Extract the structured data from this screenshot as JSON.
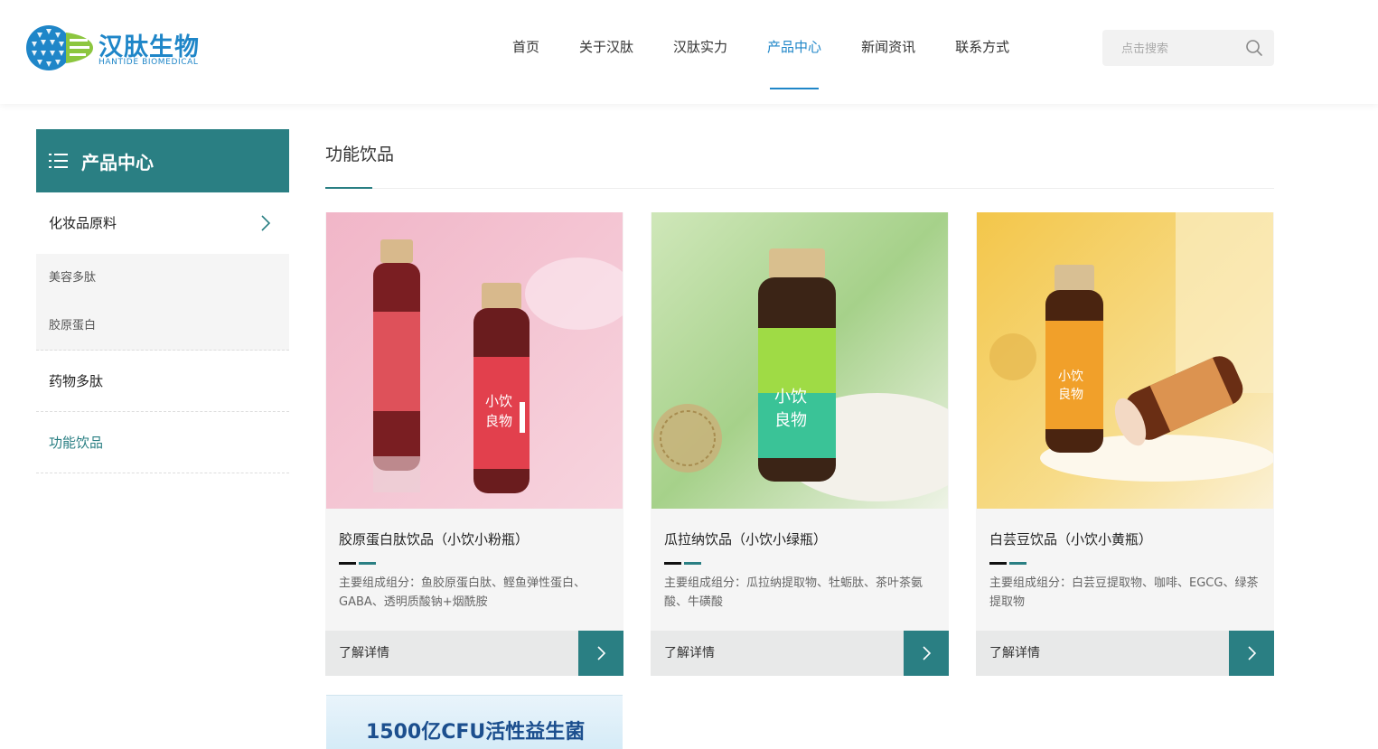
{
  "brand": {
    "name_cn": "汉肽生物",
    "name_en": "HANTIDE BIOMEDICAL"
  },
  "nav": {
    "items": [
      {
        "label": "首页"
      },
      {
        "label": "关于汉肽"
      },
      {
        "label": "汉肽实力"
      },
      {
        "label": "产品中心"
      },
      {
        "label": "新闻资讯"
      },
      {
        "label": "联系方式"
      }
    ],
    "active_index": 3
  },
  "search": {
    "placeholder": "点击搜索",
    "icon": "search-icon"
  },
  "sidebar": {
    "title": "产品中心",
    "categories": [
      {
        "label": "化妆品原料",
        "expanded": true,
        "children": [
          {
            "label": "美容多肽"
          },
          {
            "label": "胶原蛋白"
          }
        ]
      },
      {
        "label": "药物多肽"
      },
      {
        "label": "功能饮品",
        "active": true
      }
    ]
  },
  "main": {
    "title": "功能饮品",
    "more_label": "了解详情",
    "products": [
      {
        "title": "胶原蛋白肽饮品（小饮小粉瓶）",
        "desc": "主要组成组分：鱼胶原蛋白肽、鲣鱼弹性蛋白、GABA、透明质酸钠+烟酰胺",
        "bottle_label": "小饮 良物",
        "bottle_color": "#e0404f"
      },
      {
        "title": "瓜拉纳饮品（小饮小绿瓶）",
        "desc": "主要组成组分：瓜拉纳提取物、牡蛎肽、茶叶茶氨酸、牛磺酸",
        "bottle_label": "小饮 良物",
        "bottle_color": "#43c6a8"
      },
      {
        "title": "白芸豆饮品（小饮小黄瓶）",
        "desc": "主要组成组分：白芸豆提取物、咖啡、EGCG、绿茶提取物",
        "bottle_label": "小饮 良物",
        "bottle_color": "#e9a12a"
      }
    ],
    "partial_card_text": "1500亿CFU活性益生菌"
  },
  "colors": {
    "accent": "#2a7f83",
    "nav_active": "#1f86c8"
  }
}
